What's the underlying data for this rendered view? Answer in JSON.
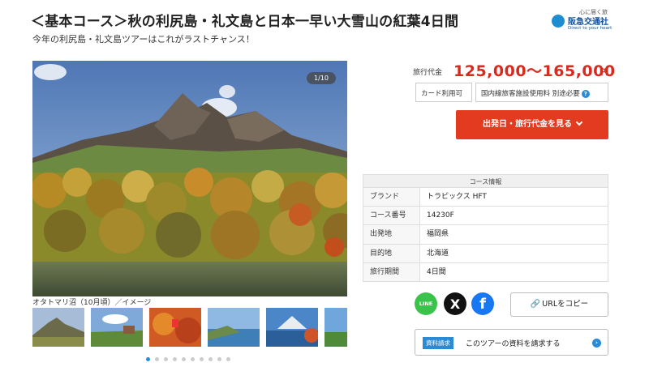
{
  "header": {
    "title": "＜基本コース＞秋の利尻島・礼文島と日本一早い大雪山の紅葉4日間",
    "subtitle": "今年の利尻島・礼文島ツアーはこれがラストチャンス！"
  },
  "logo": {
    "tagline": "心に届く旅",
    "name": "阪急交通社",
    "sub": "Direct to your heart"
  },
  "gallery": {
    "counter": "1/10",
    "caption": "オタトマリ沼（10月頃）／イメージ",
    "thumbnail_count": 6,
    "dot_count": 10,
    "active_dot": 0
  },
  "price": {
    "label": "旅行代金",
    "value": "125,000〜165,000",
    "unit": "円"
  },
  "badges": {
    "card": "カード利用可",
    "facility_fee": "国内線旅客施設使用料 別途必要",
    "help_icon": "?"
  },
  "cta": {
    "label": "出発日・旅行代金を見る"
  },
  "course_info": {
    "heading": "コース情報",
    "rows": [
      {
        "key": "ブランド",
        "value": "トラピックス HFT"
      },
      {
        "key": "コース番号",
        "value": "14230F"
      },
      {
        "key": "出発地",
        "value": "福岡県"
      },
      {
        "key": "目的地",
        "value": "北海道"
      },
      {
        "key": "旅行期間",
        "value": "4日間"
      }
    ]
  },
  "share": {
    "line_label": "LINE",
    "x_label": "X",
    "facebook_label": "f",
    "copy_url_label": "URLをコピー"
  },
  "request": {
    "tag": "資料請求",
    "text": "このツアーの資料を請求する"
  },
  "colors": {
    "price_red": "#d72b1f",
    "cta_red": "#e23b1f",
    "accent_blue": "#2a8bd4"
  }
}
